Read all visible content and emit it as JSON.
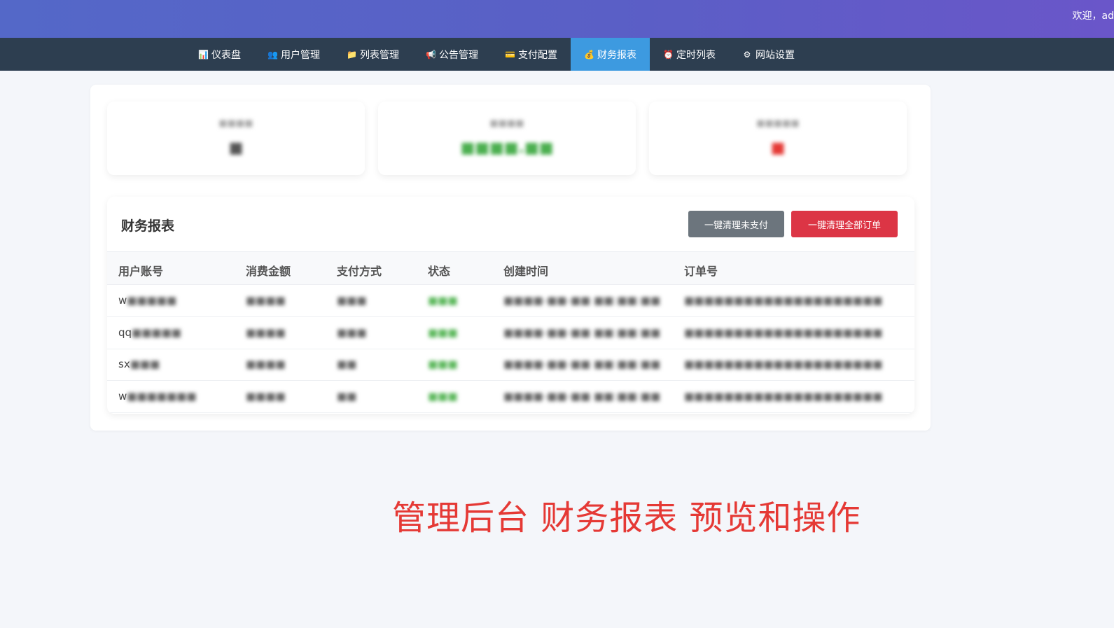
{
  "header": {
    "welcome": "欢迎，ad"
  },
  "nav": {
    "items": [
      {
        "label": "仪表盘",
        "icon": "📊"
      },
      {
        "label": "用户管理",
        "icon": "👥"
      },
      {
        "label": "列表管理",
        "icon": "📁"
      },
      {
        "label": "公告管理",
        "icon": "📢"
      },
      {
        "label": "支付配置",
        "icon": "💳"
      },
      {
        "label": "财务报表",
        "icon": "💰"
      },
      {
        "label": "定时列表",
        "icon": "⏰"
      },
      {
        "label": "网站设置",
        "icon": "⚙"
      }
    ],
    "active_index": 5
  },
  "stats": [
    {
      "label": "■■■■",
      "value": "■",
      "color": "#555555"
    },
    {
      "label": "■■■■",
      "value": "■■■■.■■",
      "color": "#4caf50"
    },
    {
      "label": "■■■■■",
      "value": "■",
      "color": "#e53935"
    }
  ],
  "report": {
    "title": "财务报表",
    "btn_clear_unpaid": "一键清理未支付",
    "btn_clear_all": "一键清理全部订单",
    "columns": [
      "用户账号",
      "消费金额",
      "支付方式",
      "状态",
      "创建时间",
      "订单号"
    ],
    "rows": [
      {
        "account_visible": "w",
        "account_hidden": "■■■■■",
        "amount": "■■■■",
        "method": "■■■",
        "status": "■■■",
        "created": "■■■■-■■-■■ ■■:■■:■■",
        "order": "■■■■■■■■■■■■■■■■■■■■"
      },
      {
        "account_visible": "qq",
        "account_hidden": "■■■■■",
        "amount": "■■■■",
        "method": "■■■",
        "status": "■■■",
        "created": "■■■■-■■-■■ ■■:■■:■■",
        "order": "■■■■■■■■■■■■■■■■■■■■"
      },
      {
        "account_visible": "sx",
        "account_hidden": "■■■",
        "amount": "■■■■",
        "method": "■■",
        "status": "■■■",
        "created": "■■■■-■■-■■ ■■:■■:■■",
        "order": "■■■■■■■■■■■■■■■■■■■■"
      },
      {
        "account_visible": "w",
        "account_hidden": "■■■■■■■",
        "amount": "■■■■",
        "method": "■■",
        "status": "■■■",
        "created": "■■■■-■■-■■ ■■:■■:■■",
        "order": "■■■■■■■■■■■■■■■■■■■■"
      }
    ]
  },
  "caption": "管理后台 财务报表 预览和操作"
}
